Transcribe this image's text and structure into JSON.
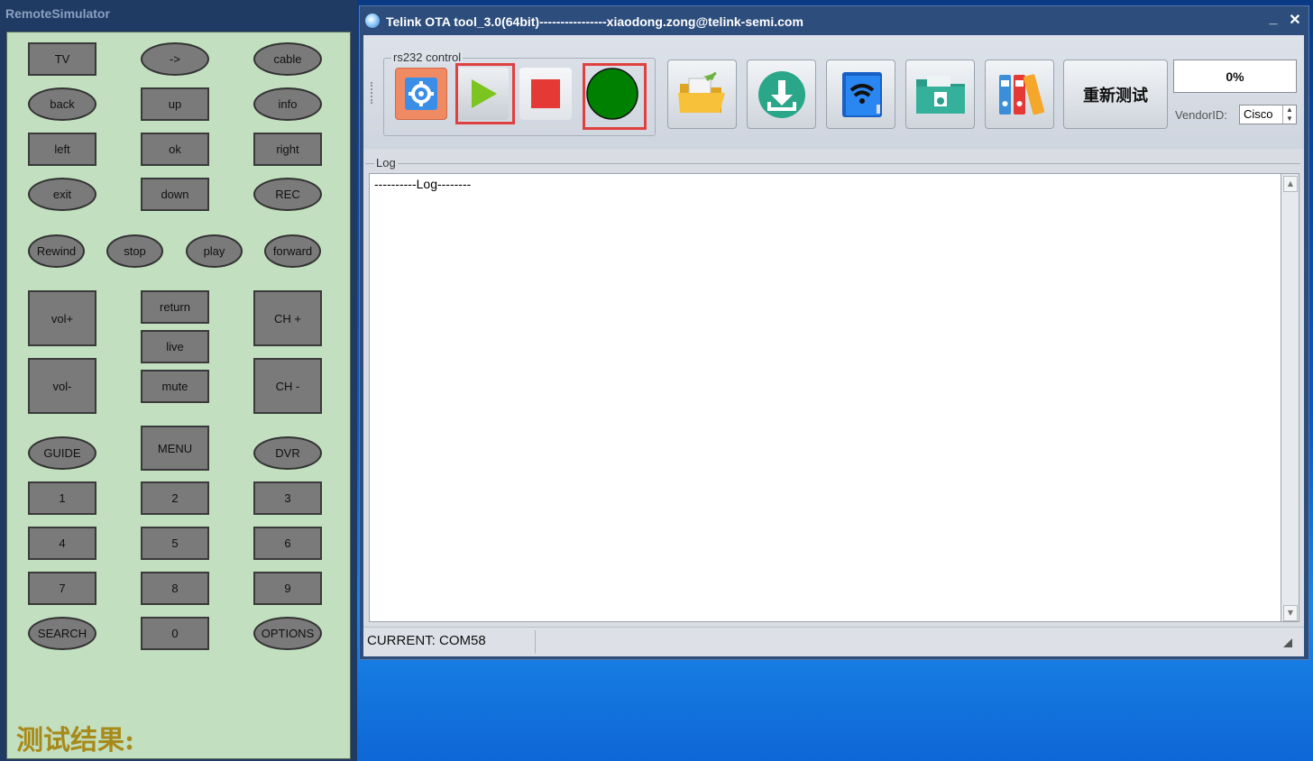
{
  "remote": {
    "title": "RemoteSimulator",
    "buttons": {
      "tv": "TV",
      "arrow": "->",
      "cable": "cable",
      "back": "back",
      "up": "up",
      "info": "info",
      "left": "left",
      "ok": "ok",
      "right": "right",
      "exit": "exit",
      "down": "down",
      "rec": "REC",
      "rewind": "Rewind",
      "stop": "stop",
      "play": "play",
      "forward": "forward",
      "vol_up": "vol+",
      "return": "return",
      "ch_up": "CH +",
      "live": "live",
      "vol_down": "vol-",
      "mute": "mute",
      "ch_down": "CH -",
      "guide": "GUIDE",
      "menu": "MENU",
      "dvr": "DVR",
      "n1": "1",
      "n2": "2",
      "n3": "3",
      "n4": "4",
      "n5": "5",
      "n6": "6",
      "n7": "7",
      "n8": "8",
      "n9": "9",
      "search": "SEARCH",
      "n0": "0",
      "options": "OPTIONS"
    },
    "test_result_label": "测试结果:"
  },
  "ota": {
    "title": "Telink OTA tool_3.0(64bit)----------------xiaodong.zong@telink-semi.com",
    "minimize": "_",
    "close": "✕",
    "rs232_label": "rs232 control",
    "retest_label": "重新测试",
    "progress": "0%",
    "vendor_label": "VendorID:",
    "vendor_value": "Cisco",
    "log_label": "Log",
    "log_content": "----------Log--------",
    "status": "CURRENT: COM58",
    "colors": {
      "highlight_red": "#e04040",
      "green_indicator": "#008000",
      "accent_blue": "#3b8ee8"
    },
    "icons": [
      "settings-icon",
      "play-icon",
      "stop-icon",
      "status-indicator",
      "open-folder-icon",
      "download-icon",
      "wifi-device-icon",
      "folder-doc-icon",
      "binders-icon"
    ]
  }
}
